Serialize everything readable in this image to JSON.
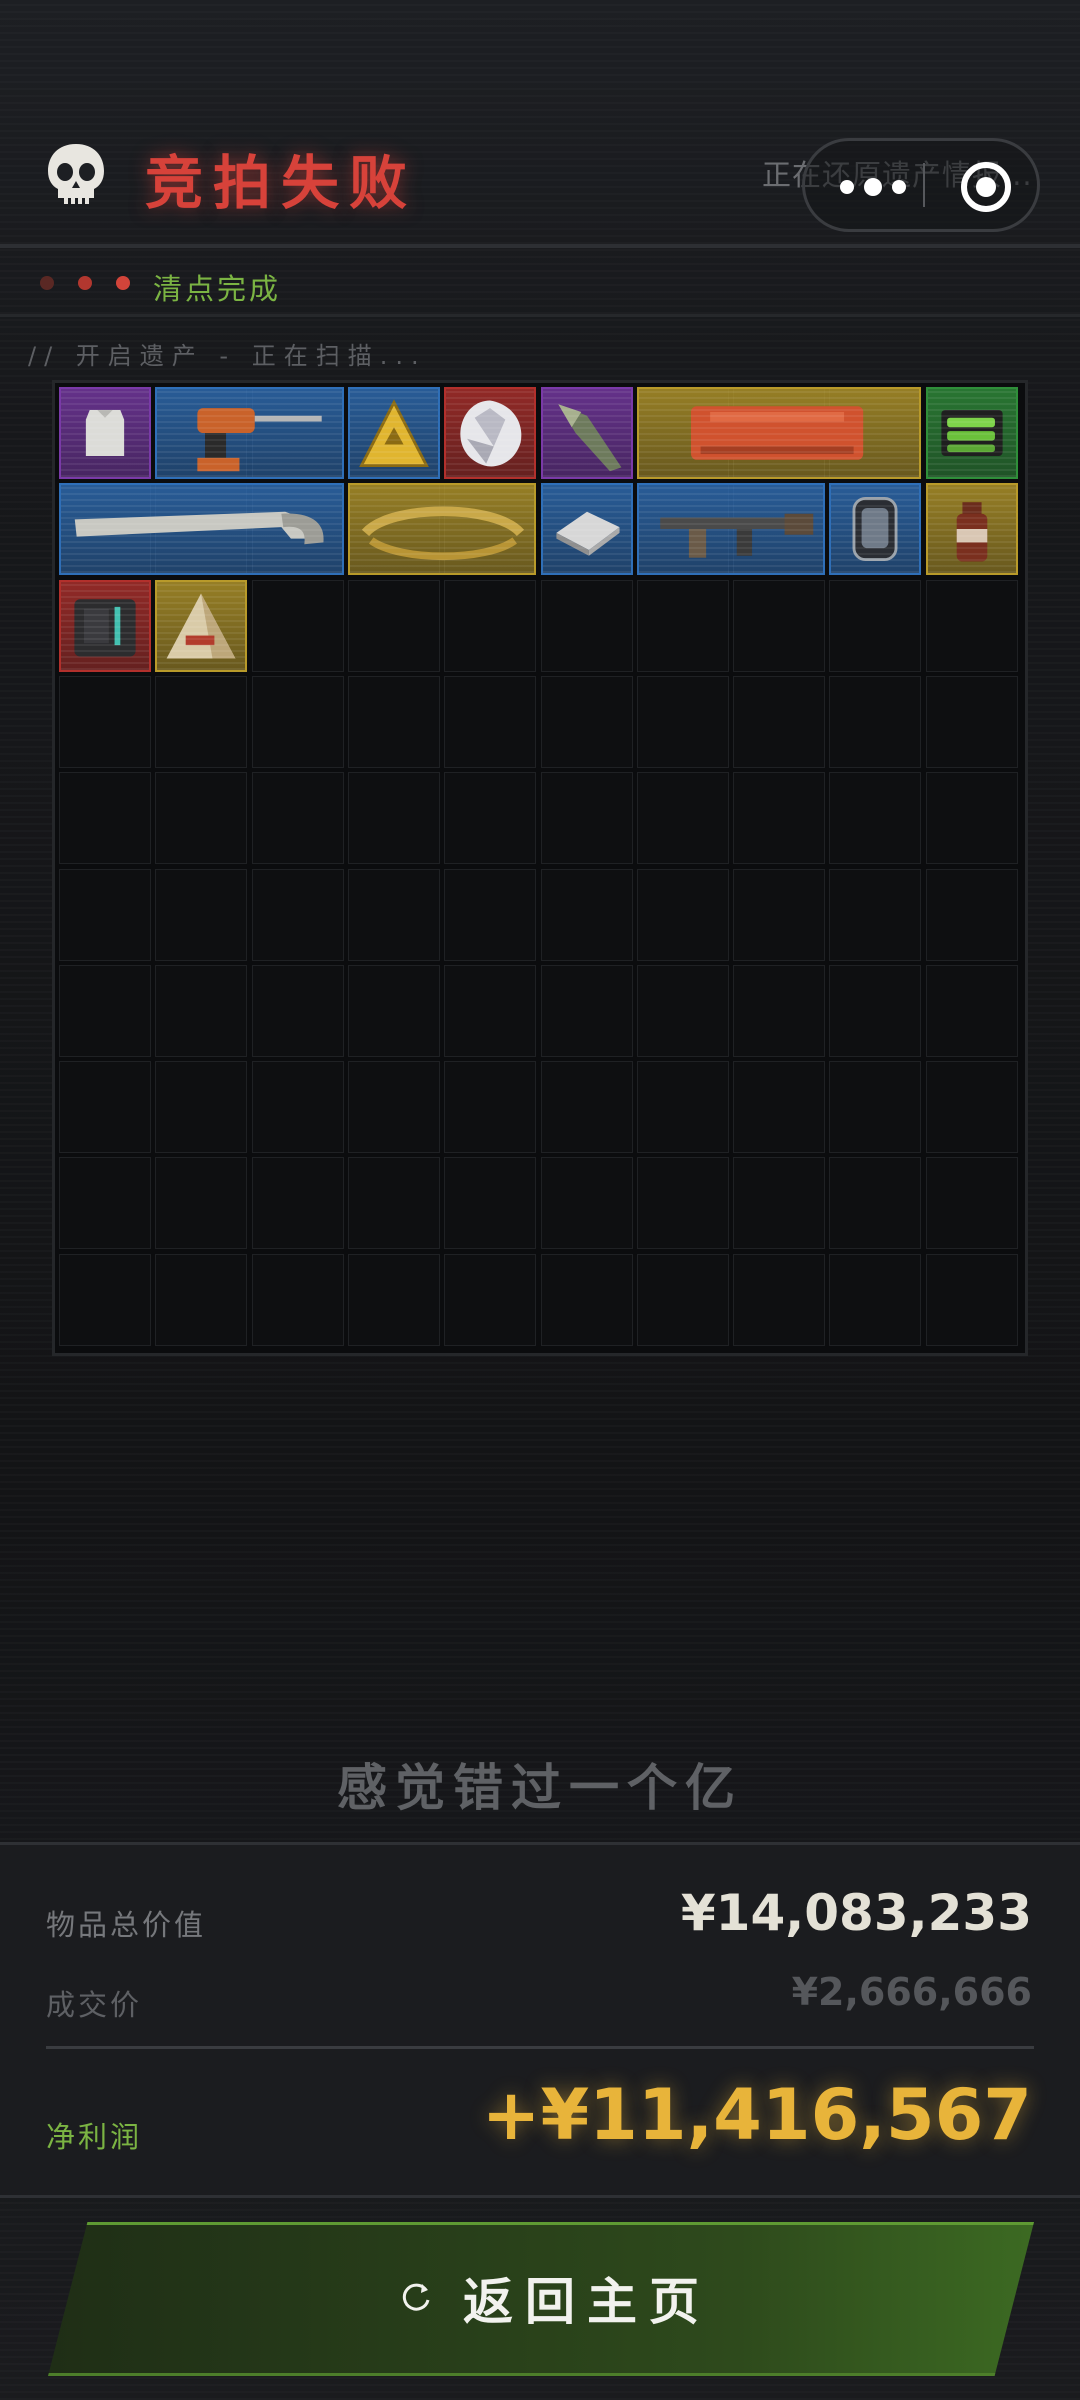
{
  "header": {
    "title": "竞拍失败",
    "restoring_text": "正在还原遗产情报...",
    "skull_icon": "skull-icon"
  },
  "status": {
    "dots": 3,
    "text": "清点完成"
  },
  "scan_text": "// 开启遗产 - 正在扫描...",
  "inventory": {
    "columns": 10,
    "rows": 10,
    "rarity_colors": {
      "purple": "#7a3aa8",
      "blue": "#2f6fb8",
      "gold": "#b89a2a",
      "red": "#b2302c",
      "green": "#2f8f3a"
    },
    "items": [
      {
        "name": "body-armor-plate",
        "rarity": "purple",
        "col": 0,
        "row": 0,
        "w": 1,
        "h": 1
      },
      {
        "name": "power-drill",
        "rarity": "blue",
        "col": 1,
        "row": 0,
        "w": 2,
        "h": 1
      },
      {
        "name": "triangle-sign",
        "rarity": "blue",
        "col": 3,
        "row": 0,
        "w": 1,
        "h": 1
      },
      {
        "name": "diamond",
        "rarity": "red",
        "col": 4,
        "row": 0,
        "w": 1,
        "h": 1
      },
      {
        "name": "ancient-spearhead",
        "rarity": "purple",
        "col": 5,
        "row": 0,
        "w": 1,
        "h": 1
      },
      {
        "name": "orange-case",
        "rarity": "gold",
        "col": 6,
        "row": 0,
        "w": 3,
        "h": 1
      },
      {
        "name": "battery-pack",
        "rarity": "green",
        "col": 9,
        "row": 0,
        "w": 1,
        "h": 1
      },
      {
        "name": "hand-saw",
        "rarity": "blue",
        "col": 0,
        "row": 1,
        "w": 3,
        "h": 1
      },
      {
        "name": "golden-laurel-wreath",
        "rarity": "gold",
        "col": 3,
        "row": 1,
        "w": 2,
        "h": 1
      },
      {
        "name": "cpu-chip",
        "rarity": "blue",
        "col": 5,
        "row": 1,
        "w": 1,
        "h": 1
      },
      {
        "name": "assault-rifle",
        "rarity": "blue",
        "col": 6,
        "row": 1,
        "w": 2,
        "h": 1
      },
      {
        "name": "smart-watch",
        "rarity": "blue",
        "col": 8,
        "row": 1,
        "w": 1,
        "h": 1
      },
      {
        "name": "drink-bottle",
        "rarity": "gold",
        "col": 9,
        "row": 1,
        "w": 1,
        "h": 1
      },
      {
        "name": "tech-device",
        "rarity": "red",
        "col": 0,
        "row": 2,
        "w": 1,
        "h": 1
      },
      {
        "name": "pyramid-box",
        "rarity": "gold",
        "col": 1,
        "row": 2,
        "w": 1,
        "h": 1
      }
    ]
  },
  "quote": "感觉错过一个亿",
  "summary": {
    "total_label": "物品总价值",
    "total_value": "¥14,083,233",
    "deal_label": "成交价",
    "deal_value": "¥2,666,666",
    "profit_label": "净利润",
    "profit_value": "+¥11,416,567"
  },
  "button": {
    "label": "返回主页",
    "icon": "refresh-icon"
  },
  "colors": {
    "title_red": "#d7423a",
    "status_green": "#7bb443",
    "profit_gold": "#e8b43a",
    "button_green": "#2e4a1c"
  }
}
